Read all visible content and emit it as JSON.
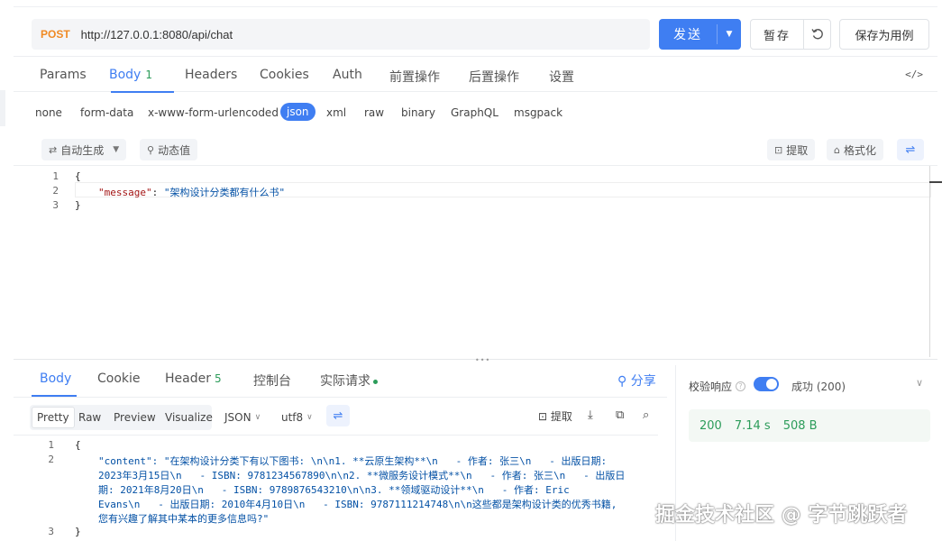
{
  "request": {
    "method": "POST",
    "url": "http://127.0.0.1:8080/api/chat",
    "send_label": "发送",
    "save_label": "暂存",
    "save_example_label": "保存为用例"
  },
  "request_tabs": [
    {
      "label": "Params"
    },
    {
      "label": "Body",
      "count": "1"
    },
    {
      "label": "Headers"
    },
    {
      "label": "Cookies"
    },
    {
      "label": "Auth"
    },
    {
      "label": "前置操作"
    },
    {
      "label": "后置操作"
    },
    {
      "label": "设置"
    }
  ],
  "code_toggle": "</>",
  "body_types": [
    "none",
    "form-data",
    "x-www-form-urlencoded",
    "json",
    "xml",
    "raw",
    "binary",
    "GraphQL",
    "msgpack"
  ],
  "body_type_selected": "json",
  "tools": {
    "auto_generate": "自动生成",
    "dynamic_value": "动态值",
    "extract": "提取",
    "format": "格式化"
  },
  "request_body": {
    "line_numbers": [
      "1",
      "2",
      "3"
    ],
    "open": "{",
    "key": "\"message\"",
    "colon": ": ",
    "value": "\"架构设计分类都有什么书\"",
    "close": "}"
  },
  "response_tabs": [
    {
      "label": "Body"
    },
    {
      "label": "Cookie"
    },
    {
      "label": "Header",
      "count": "5"
    },
    {
      "label": "控制台"
    },
    {
      "label": "实际请求"
    }
  ],
  "share_label": "分享",
  "response_formats": [
    "Pretty",
    "Raw",
    "Preview",
    "Visualize"
  ],
  "response_format_selected": "Pretty",
  "response_lang": "JSON",
  "response_encoding": "utf8",
  "response_extract": "提取",
  "response_body": {
    "line_numbers": [
      "1",
      "2",
      "3"
    ],
    "open": "{",
    "lines": [
      "\"content\": \"在架构设计分类下有以下图书: \\n\\n1. **云原生架构**\\n   - 作者: 张三\\n   - 出版日期:",
      "2023年3月15日\\n   - ISBN: 9781234567890\\n\\n2. **微服务设计模式**\\n   - 作者: 张三\\n   - 出版日",
      "期: 2021年8月20日\\n   - ISBN: 9789876543210\\n\\n3. **领域驱动设计**\\n   - 作者: Eric",
      "Evans\\n   - 出版日期: 2010年4月10日\\n   - ISBN: 9787111214748\\n\\n这些都是架构设计类的优秀书籍,",
      "您有兴趣了解其中某本的更多信息吗?\""
    ],
    "close": "}"
  },
  "status": {
    "validate_label": "校验响应",
    "validate_on": true,
    "result": "成功 (200)",
    "code": "200",
    "time": "7.14 s",
    "size": "508 B"
  },
  "watermark": "掘金技术社区 @ 字节跳跃者",
  "colors": {
    "accent": "#3f7ef2",
    "method": "#f08a24",
    "success": "#2c9c5a"
  }
}
